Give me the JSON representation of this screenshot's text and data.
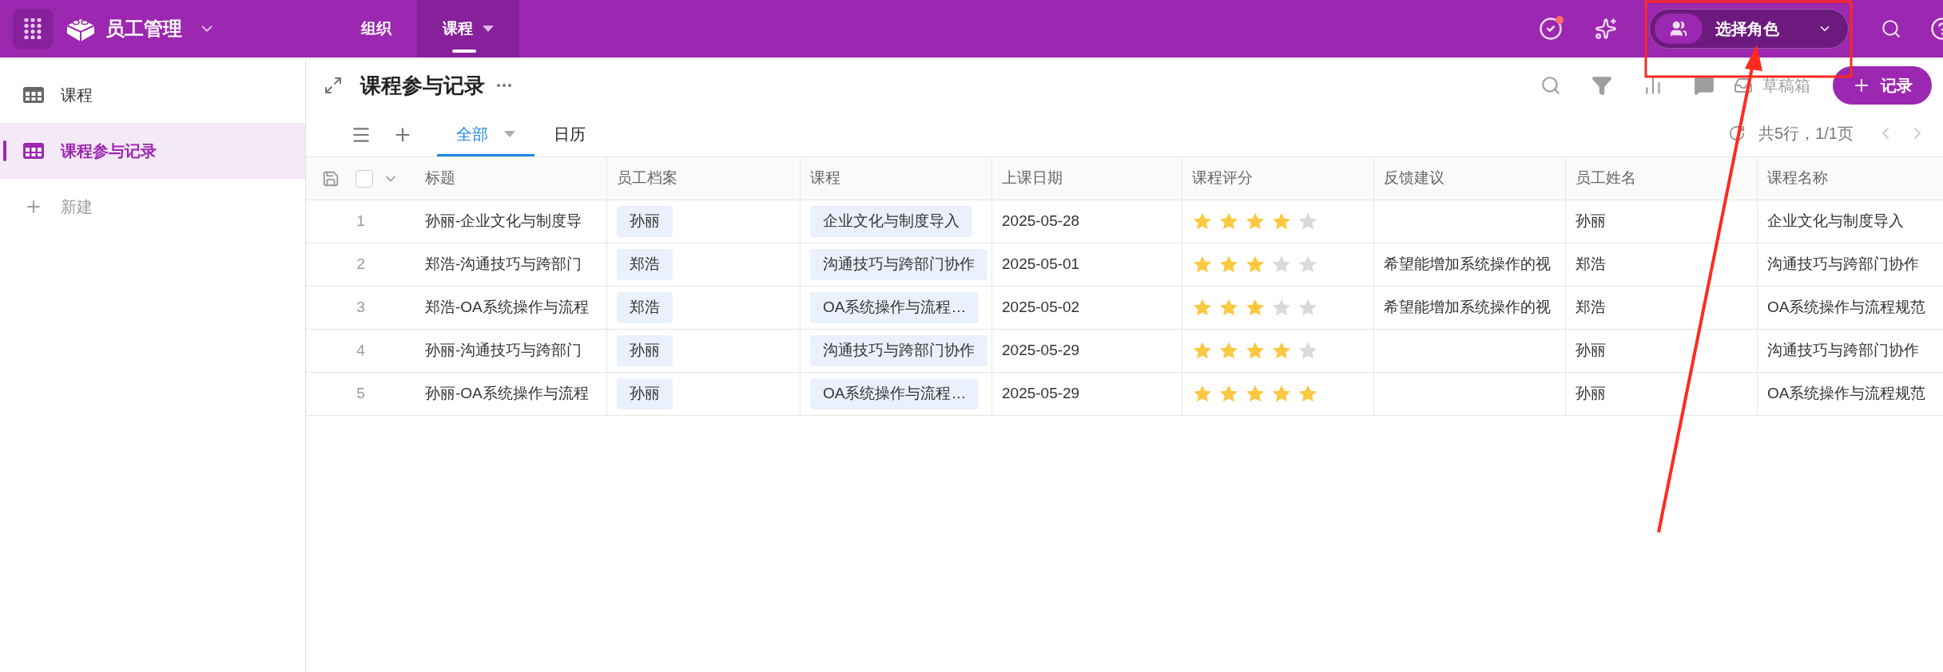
{
  "app": {
    "title": "员工管理"
  },
  "nav_tabs": [
    {
      "label": "组织",
      "selected": false
    },
    {
      "label": "课程",
      "selected": true
    }
  ],
  "role_selector": {
    "label": "选择角色"
  },
  "sidebar": {
    "items": [
      {
        "label": "课程",
        "kind": "table",
        "selected": false
      },
      {
        "label": "课程参与记录",
        "kind": "table",
        "selected": true
      },
      {
        "label": "新建",
        "kind": "add",
        "selected": false
      }
    ]
  },
  "page": {
    "title": "课程参与记录",
    "drafts": "草稿箱",
    "add_record": "记录"
  },
  "views": [
    {
      "label": "全部",
      "selected": true
    },
    {
      "label": "日历",
      "selected": false
    }
  ],
  "pagination": "共5行，1/1页",
  "select_all": {
    "checked": false
  },
  "table": {
    "columns": [
      "标题",
      "员工档案",
      "课程",
      "上课日期",
      "课程评分",
      "反馈建议",
      "员工姓名",
      "课程名称"
    ],
    "rows": [
      {
        "index": "1",
        "title": "孙丽-企业文化与制度导",
        "employee": "孙丽",
        "course": "企业文化与制度导入",
        "date": "2025-05-28",
        "stars": 4,
        "feedback": "",
        "name": "孙丽",
        "course_name": "企业文化与制度导入"
      },
      {
        "index": "2",
        "title": "郑浩-沟通技巧与跨部门",
        "employee": "郑浩",
        "course": "沟通技巧与跨部门协作",
        "date": "2025-05-01",
        "stars": 3,
        "feedback": "希望能增加系统操作的视",
        "name": "郑浩",
        "course_name": "沟通技巧与跨部门协作"
      },
      {
        "index": "3",
        "title": "郑浩-OA系统操作与流程",
        "employee": "郑浩",
        "course": "OA系统操作与流程…",
        "date": "2025-05-02",
        "stars": 3,
        "feedback": "希望能增加系统操作的视",
        "name": "郑浩",
        "course_name": "OA系统操作与流程规范"
      },
      {
        "index": "4",
        "title": "孙丽-沟通技巧与跨部门",
        "employee": "孙丽",
        "course": "沟通技巧与跨部门协作",
        "date": "2025-05-29",
        "stars": 4,
        "feedback": "",
        "name": "孙丽",
        "course_name": "沟通技巧与跨部门协作"
      },
      {
        "index": "5",
        "title": "孙丽-OA系统操作与流程",
        "employee": "孙丽",
        "course": "OA系统操作与流程…",
        "date": "2025-05-29",
        "stars": 5,
        "feedback": "",
        "name": "孙丽",
        "course_name": "OA系统操作与流程规范"
      }
    ]
  }
}
